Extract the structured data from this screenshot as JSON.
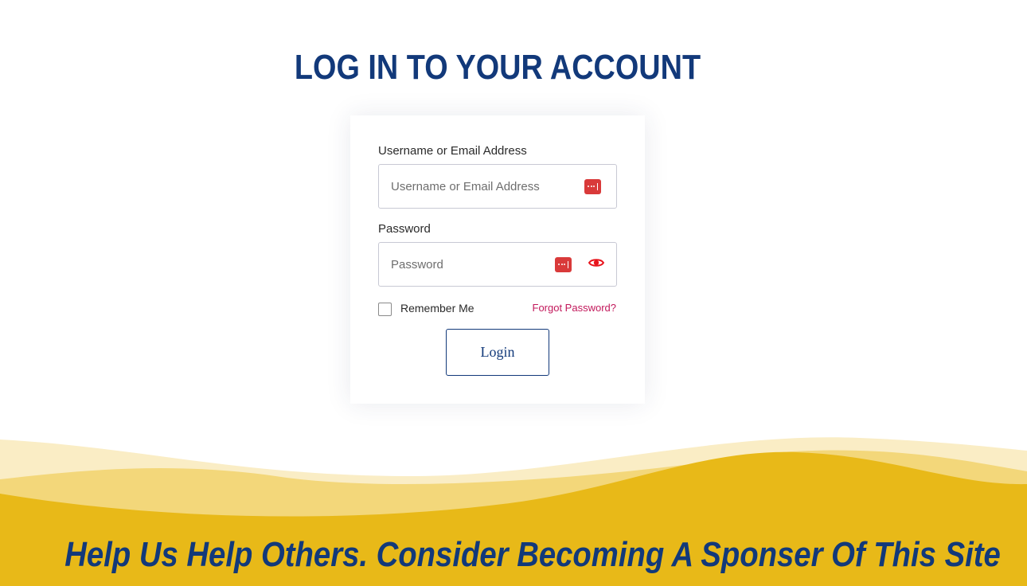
{
  "page": {
    "title": "LOG IN TO YOUR ACCOUNT"
  },
  "login_form": {
    "username_label": "Username or Email Address",
    "username_placeholder": "Username or Email Address",
    "username_value": "",
    "password_label": "Password",
    "password_placeholder": "Password",
    "password_value": "",
    "remember_label": "Remember Me",
    "remember_checked": false,
    "forgot_label": "Forgot Password?",
    "submit_label": "Login",
    "password_manager_icon": "password-manager-icon",
    "show_password_icon": "eye-icon"
  },
  "footer": {
    "sponsor_text": "Help Us Help Others. Consider Becoming A Sponser Of This Site"
  },
  "colors": {
    "brand_navy": "#12397a",
    "accent_gold": "#e8b918",
    "link_pink": "#c2185b",
    "pm_red": "#d93a3a",
    "eye_red": "#e8141c"
  }
}
